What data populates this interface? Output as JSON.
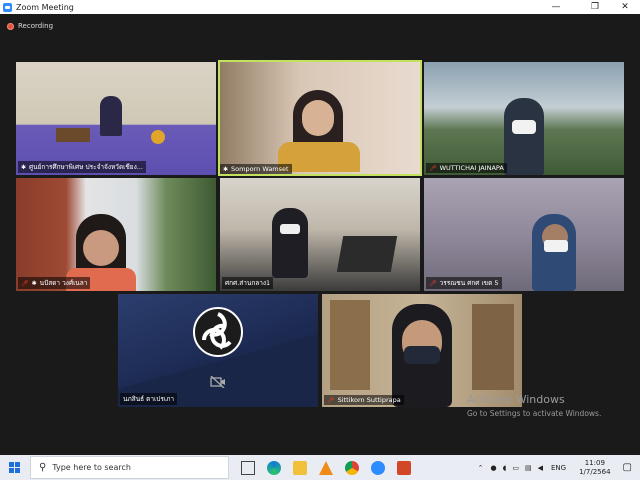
{
  "window": {
    "title": "Zoom Meeting",
    "controls": {
      "minimize": "—",
      "maximize": "❐",
      "close": "✕"
    }
  },
  "meeting": {
    "recording_label": "Recording",
    "participants": [
      {
        "name": "ศูนย์การศึกษาพิเศษ ประจำจังหวัดเชียง...",
        "muted": true,
        "active": false
      },
      {
        "name": "Somporn Wamset",
        "muted": false,
        "active": true
      },
      {
        "name": "WUTTICHAI JAINAPA",
        "muted": true,
        "active": false
      },
      {
        "name": "นปัสดา วงศ์เนลา",
        "muted": true,
        "active": false
      },
      {
        "name": "ศกศ.ส่านกลาง1",
        "muted": false,
        "active": false
      },
      {
        "name": "วรรณชน ศกศ เขต 5",
        "muted": true,
        "active": false
      },
      {
        "name": "นภสินธ์ ตาเปรเภา",
        "muted": false,
        "active": false,
        "video_off": true
      },
      {
        "name": "Sittikorn Suttiprapa",
        "muted": true,
        "active": false
      }
    ]
  },
  "watermark": {
    "line1": "Activate Windows",
    "line2": "Go to Settings to activate Windows."
  },
  "taskbar": {
    "search_placeholder": "Type here to search",
    "language": "ENG",
    "time": "11:09",
    "date": "1/7/2564"
  },
  "colors": {
    "active_speaker_border": "#c2e15f",
    "muted_icon": "#ff3b30",
    "background": "#1a1a1a"
  }
}
